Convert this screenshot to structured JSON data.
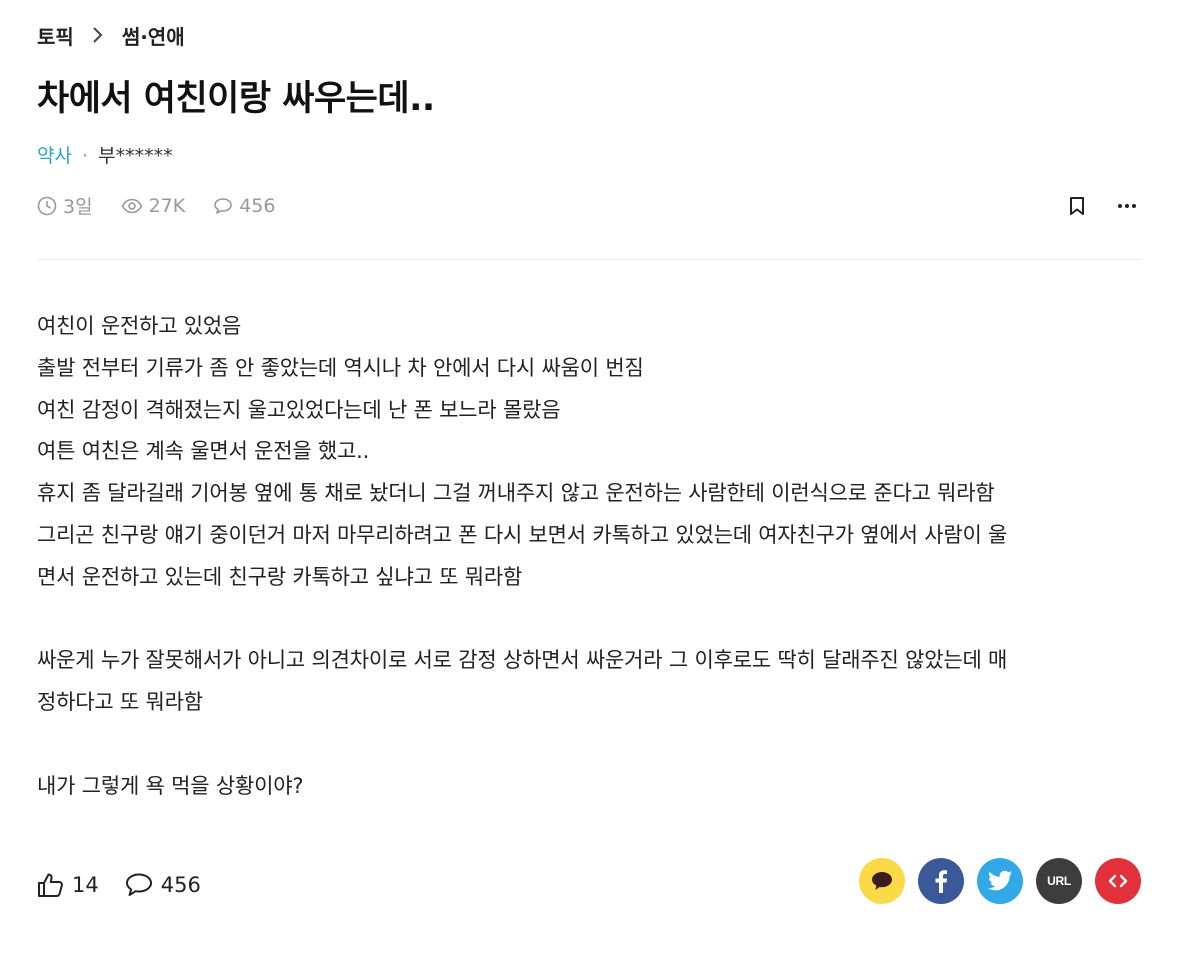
{
  "breadcrumb": {
    "root": "토픽",
    "current": "썸·연애"
  },
  "post": {
    "title": "차에서 여친이랑 싸우는데..",
    "author_job": "약사",
    "author_separator": "·",
    "author_name": "부******",
    "time": "3일",
    "views": "27K",
    "comments": "456"
  },
  "content": {
    "lines": [
      "여친이 운전하고 있었음",
      "출발 전부터 기류가 좀 안 좋았는데 역시나 차 안에서 다시 싸움이 번짐",
      "여친 감정이 격해졌는지 울고있었다는데 난 폰 보느라 몰랐음",
      "여튼 여친은 계속 울면서 운전을 했고..",
      "휴지 좀 달라길래 기어봉 옆에 통 채로 놨더니 그걸 꺼내주지 않고 운전하는 사람한테 이런식으로 준다고 뭐라함",
      "그리곤 친구랑 얘기 중이던거 마저 마무리하려고 폰 다시 보면서 카톡하고 있었는데 여자친구가 옆에서 사람이 울",
      "면서 운전하고 있는데 친구랑 카톡하고 싶냐고 또 뭐라함",
      "",
      "싸운게 누가 잘못해서가 아니고 의견차이로 서로 감정 상하면서 싸운거라 그 이후로도 딱히 달래주진 않았는데 매",
      "정하다고 또 뭐라함",
      "",
      "내가 그렇게 욕 먹을 상황이야?"
    ]
  },
  "footer": {
    "likes": "14",
    "comments": "456",
    "share_url_label": "URL"
  },
  "colors": {
    "accent": "#2ba5c4",
    "kakao": "#fcd947",
    "facebook": "#3b5998",
    "twitter": "#33a8e8",
    "url": "#3d3d3d",
    "embed": "#e2313a"
  }
}
